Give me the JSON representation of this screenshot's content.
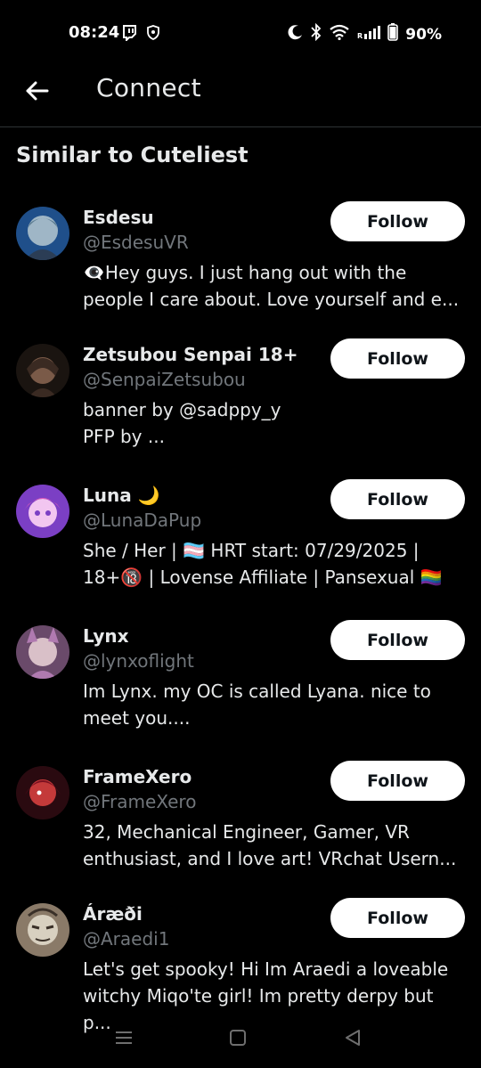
{
  "status_bar": {
    "time": "08:24",
    "battery": "90%",
    "left_icons": [
      "twitch-icon",
      "vpn-shield-icon"
    ],
    "right_icons": [
      "moon-icon",
      "bluetooth-icon",
      "wifi-icon",
      "signal-icon",
      "battery-icon"
    ]
  },
  "header": {
    "title": "Connect"
  },
  "section": {
    "title": "Similar to Cuteliest"
  },
  "users": [
    {
      "name": "Esdesu",
      "handle": "@EsdesuVR",
      "bio": "👁️‍🗨️Hey guys. I just hang out with the\npeople I care about. Love yourself and e...",
      "follow_label": "Follow",
      "avatar_colors": [
        "#1f4f8a",
        "#9fb6c6",
        "#2b3d55"
      ]
    },
    {
      "name": "Zetsubou Senpai 18+",
      "handle": "@SenpaiZetsubou",
      "bio": "banner by @sadppy_y\nPFP by ...",
      "follow_label": "Follow",
      "avatar_colors": [
        "#3a2a22",
        "#7a5a48",
        "#1a1410"
      ]
    },
    {
      "name": "Luna 🌙",
      "handle": "@LunaDaPup",
      "bio": "She / Her | 🏳️‍⚧️ HRT start: 07/29/2025 |\n18+🔞 | Lovense Affiliate | Pansexual 🏳️‍🌈",
      "follow_label": "Follow",
      "avatar_colors": [
        "#7b3fc4",
        "#e05ab8",
        "#f2c6f0"
      ]
    },
    {
      "name": "Lynx",
      "handle": "@lynxoflight",
      "bio": "Im Lynx. my OC is called Lyana. nice to\nmeet you....",
      "follow_label": "Follow",
      "avatar_colors": [
        "#b07ab0",
        "#d9c0c8",
        "#6a4a6a"
      ]
    },
    {
      "name": "FrameXero",
      "handle": "@FrameXero",
      "bio": "32, Mechanical Engineer, Gamer, VR\nenthusiast, and I love art! VRchat Usern...",
      "follow_label": "Follow",
      "avatar_colors": [
        "#7a1020",
        "#c43a3a",
        "#2a0a10"
      ]
    },
    {
      "name": "Áræði",
      "handle": "@Araedi1",
      "bio": "Let's get spooky! Hi Im Araedi a loveable\nwitchy Miqo'te girl! Im pretty derpy but p...",
      "follow_label": "Follow",
      "avatar_colors": [
        "#d8d0c0",
        "#3a3028",
        "#8a7a68"
      ]
    }
  ],
  "nav": {
    "items": [
      "recents-icon",
      "home-icon",
      "back-icon"
    ]
  }
}
